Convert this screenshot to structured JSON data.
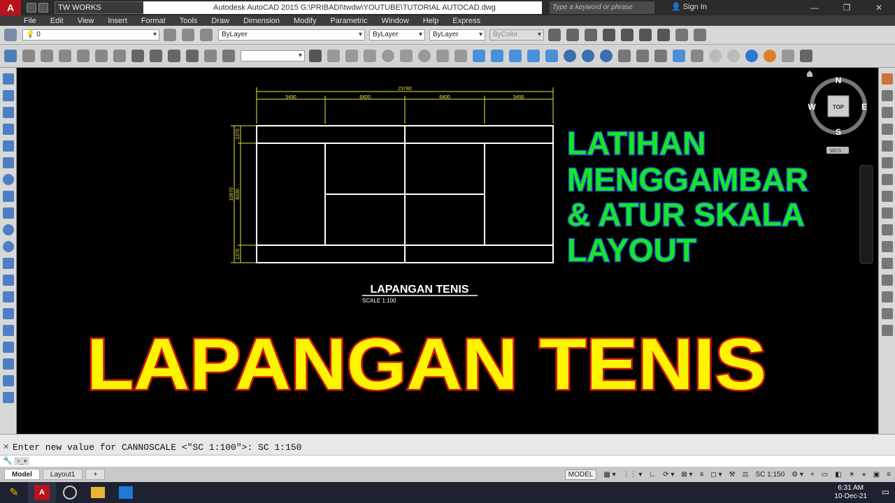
{
  "titlebar": {
    "workspace": "TW WORKS",
    "title": "Autodesk AutoCAD 2015    G:\\PRIBADI\\twdw\\YOUTUBE\\TUTORIAL AUTOCAD.dwg",
    "search_placeholder": "Type a keyword or phrase",
    "signin": "Sign In"
  },
  "menu": [
    "File",
    "Edit",
    "View",
    "Insert",
    "Format",
    "Tools",
    "Draw",
    "Dimension",
    "Modify",
    "Parametric",
    "Window",
    "Help",
    "Express"
  ],
  "properties": {
    "layer": "0",
    "color": "ByLayer",
    "linetype": "ByLayer",
    "lineweight": "ByLayer",
    "plotstyle": "ByColor"
  },
  "viewcube": {
    "n": "N",
    "s": "S",
    "e": "E",
    "w": "W",
    "top": "TOP",
    "wcs": "WCS"
  },
  "drawing": {
    "dim_total": "23780",
    "dim_a": "5490",
    "dim_b": "6400",
    "dim_c": "6400",
    "dim_d": "5490",
    "dim_v1": "1370",
    "dim_v2": "10970",
    "dim_v3": "8230",
    "dim_v4": "1370",
    "label_title": "LAPANGAN TENIS",
    "label_scale": "SCALE  1:100"
  },
  "overlay": {
    "subtitle_lines": [
      "LATIHAN",
      "MENGGAMBAR",
      "& ATUR SKALA",
      "LAYOUT"
    ],
    "headline": "LAPANGAN TENIS"
  },
  "command": {
    "history": "Enter new value for CANNOSCALE <\"SC 1:100\">: SC 1:150",
    "prompt": ""
  },
  "tabs": [
    "Model",
    "Layout1"
  ],
  "status": {
    "space": "MODEL",
    "scale": "SC 1:150"
  },
  "clock": {
    "time": "6:31 AM",
    "date": "10-Dec-21"
  },
  "colors": {
    "court_line": "#ffffff",
    "dimension": "#e8e64a",
    "subtitle_fill": "#15e62a",
    "subtitle_stroke": "#1a3fb5",
    "headline_fill": "#fdf400",
    "headline_stroke": "#c81b14"
  }
}
